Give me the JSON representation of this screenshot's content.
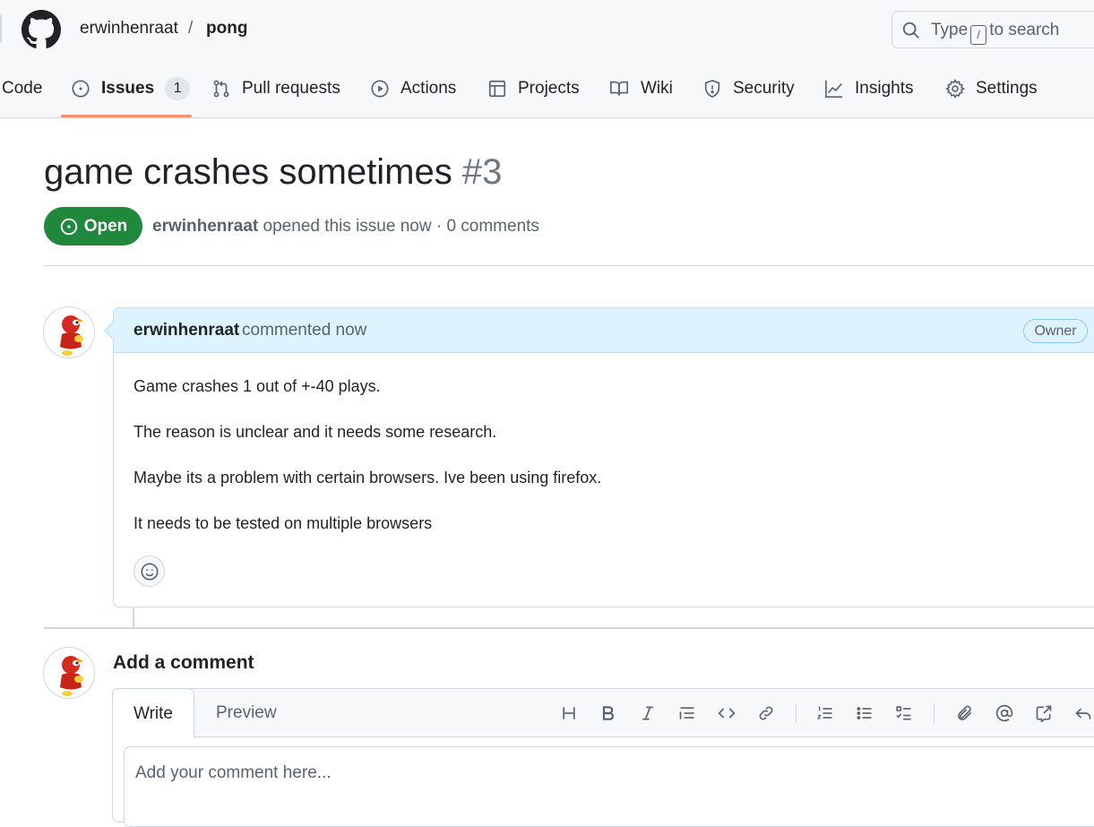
{
  "repo": {
    "owner": "erwinhenraat",
    "separator": "/",
    "name": "pong",
    "logo_icon": "github-mark-icon"
  },
  "search": {
    "prefix": "Type",
    "key": "/",
    "suffix": "to search",
    "icon": "search-icon"
  },
  "tabs": [
    {
      "label": "Code",
      "icon": "code-icon"
    },
    {
      "label": "Issues",
      "icon": "issue-opened-icon",
      "counter": "1",
      "active": true
    },
    {
      "label": "Pull requests",
      "icon": "git-pull-request-icon"
    },
    {
      "label": "Actions",
      "icon": "play-icon"
    },
    {
      "label": "Projects",
      "icon": "table-icon"
    },
    {
      "label": "Wiki",
      "icon": "book-icon"
    },
    {
      "label": "Security",
      "icon": "shield-icon"
    },
    {
      "label": "Insights",
      "icon": "graph-icon"
    },
    {
      "label": "Settings",
      "icon": "gear-icon"
    }
  ],
  "issue": {
    "title": "game crashes sometimes",
    "number": "#3",
    "state": "Open",
    "author": "erwinhenraat",
    "meta_text": "opened this issue now · 0 comments"
  },
  "comment": {
    "author": "erwinhenraat",
    "action": "commented now",
    "badge": "Owner",
    "paragraphs": [
      "Game crashes 1 out of +-40 plays.",
      "The reason is unclear and it needs some research.",
      "Maybe its a problem with certain browsers. Ive been using firefox.",
      "It needs to be tested on multiple browsers"
    ]
  },
  "add_comment": {
    "title": "Add a comment",
    "tab_write": "Write",
    "tab_preview": "Preview",
    "placeholder": "Add your comment here...",
    "toolbar": [
      "heading-icon",
      "bold-icon",
      "italic-icon",
      "quote-icon",
      "code-icon",
      "link-icon",
      "ordered-list-icon",
      "unordered-list-icon",
      "task-list-icon",
      "attach-icon",
      "mention-icon",
      "cross-reference-icon",
      "reply-icon"
    ]
  },
  "colors": {
    "open_green": "#1f883d",
    "tab_underline": "#fd8c73",
    "comment_header": "#ddf4ff"
  }
}
